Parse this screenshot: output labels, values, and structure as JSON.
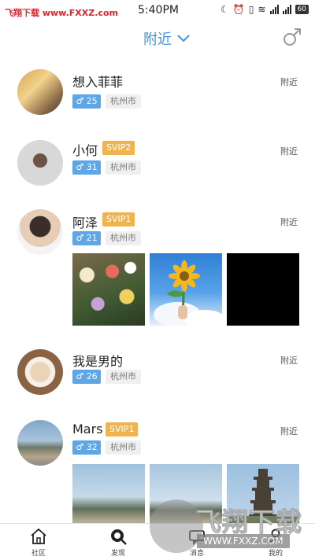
{
  "status_bar": {
    "watermark": "飞翔下载 www.FXXZ.com",
    "time": "5:40PM",
    "battery": "60"
  },
  "header": {
    "title": "附近"
  },
  "posts": [
    {
      "name": "想入菲菲",
      "svip": "",
      "age": "25",
      "city": "杭州市",
      "distance": "附近"
    },
    {
      "name": "小何",
      "svip": "SVIP2",
      "age": "31",
      "city": "杭州市",
      "distance": "附近"
    },
    {
      "name": "阿泽",
      "svip": "SVIP1",
      "age": "21",
      "city": "杭州市",
      "distance": "附近"
    },
    {
      "name": "我是男的",
      "svip": "",
      "age": "26",
      "city": "杭州市",
      "distance": "附近"
    },
    {
      "name": "Mars",
      "svip": "SVIP1",
      "age": "32",
      "city": "杭州市",
      "distance": "附近"
    }
  ],
  "gender_symbol": "♂",
  "tabbar": {
    "tabs": [
      {
        "label": "社区",
        "icon": "home-icon"
      },
      {
        "label": "发现",
        "icon": "discover-icon"
      },
      {
        "label": "消息",
        "icon": "message-icon"
      },
      {
        "label": "我的",
        "icon": "profile-icon"
      }
    ]
  },
  "watermark_logo": {
    "text": "飞翔下载",
    "url": "WWW.FXXZ.COM"
  },
  "colors": {
    "accent": "#4a90d9",
    "svip": "#f0b44f",
    "gender_badge": "#5ea6e6",
    "watermark_red": "#e0242b"
  }
}
